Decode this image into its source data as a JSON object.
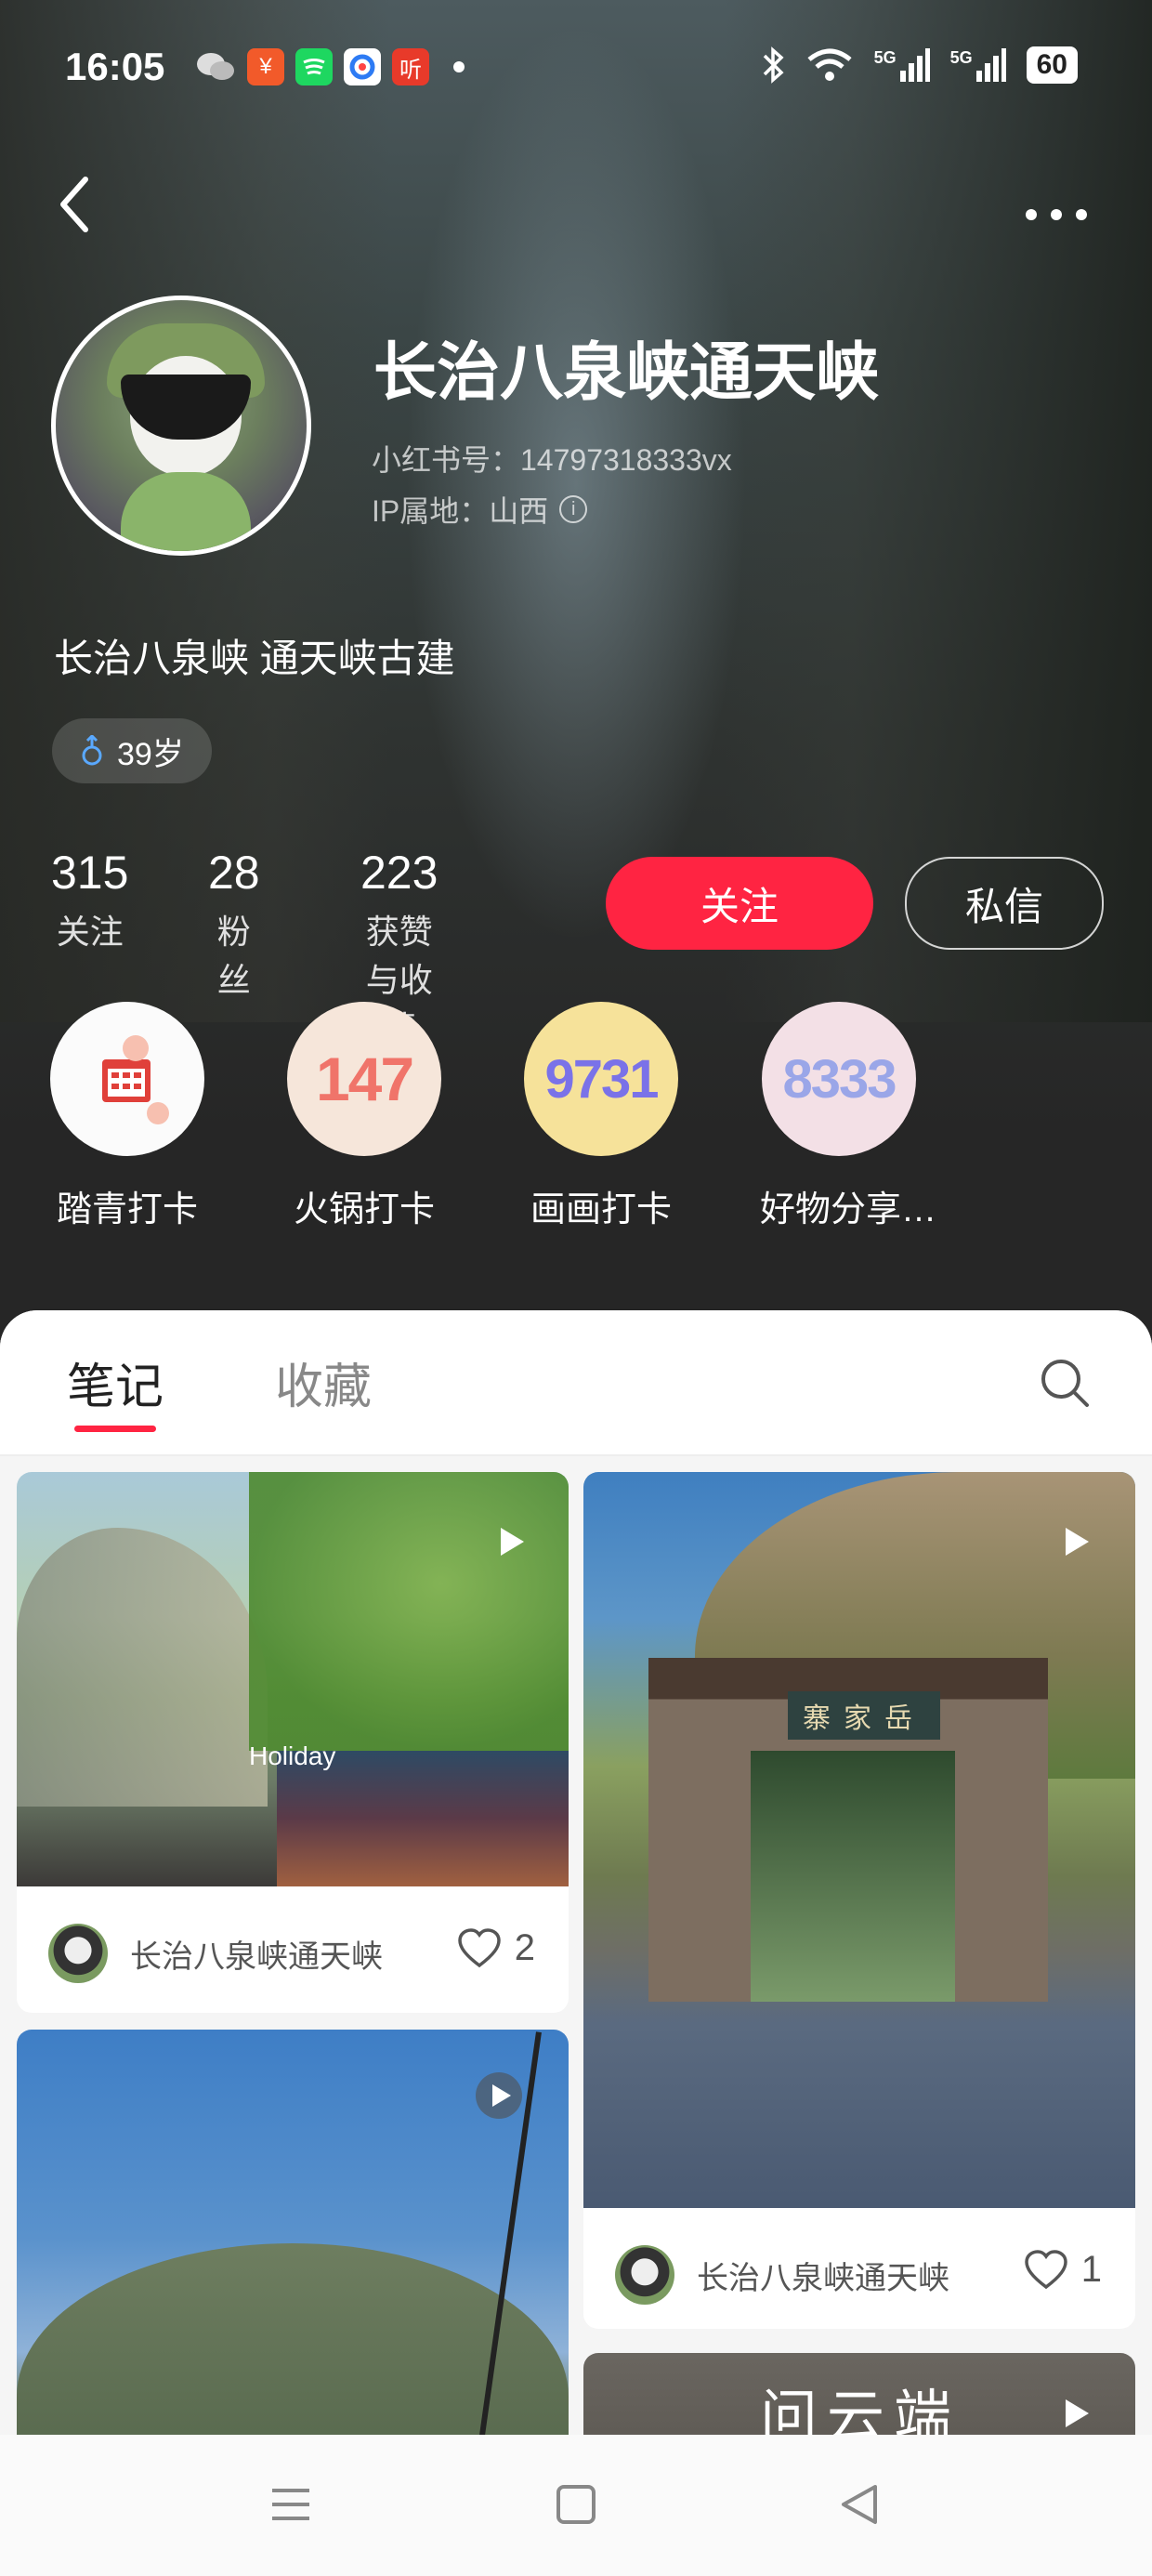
{
  "status_bar": {
    "time": "16:05",
    "battery": "60",
    "network_labels": [
      "5G",
      "5G"
    ],
    "app_badge": "听"
  },
  "header": {
    "back_icon": "chevron-left-icon",
    "more_icon": "more-dots-icon"
  },
  "profile": {
    "name": "长治八泉峡通天峡",
    "red_id": "小红书号：14797318333vx",
    "ip_location": "IP属地：山西",
    "bio": "长治八泉峡 通天峡古建",
    "age": "39岁",
    "gender_icon": "male-icon"
  },
  "stats": [
    {
      "value": "315",
      "label": "关注"
    },
    {
      "value": "28",
      "label": "粉丝"
    },
    {
      "value": "223",
      "label": "获赞与收藏"
    }
  ],
  "actions": {
    "follow": "关注",
    "message": "私信"
  },
  "highlights": [
    {
      "label": "踏青打卡",
      "badge": ""
    },
    {
      "label": "火锅打卡",
      "badge": "147"
    },
    {
      "label": "画画打卡",
      "badge": "9731"
    },
    {
      "label": "好物分享…",
      "badge": "8333"
    }
  ],
  "tabs": {
    "notes": "笔记",
    "collections": "收藏"
  },
  "posts": [
    {
      "author": "长治八泉峡通天峡",
      "likes": "2",
      "overlay_text": "Holiday"
    },
    {
      "author": "长治八泉峡通天峡",
      "likes": "1",
      "overlay_text": "寨家岳"
    },
    {
      "author": "",
      "likes": "",
      "overlay_text": ""
    },
    {
      "author": "",
      "likes": "",
      "overlay_text": "问云端"
    }
  ],
  "colors": {
    "accent": "#ff2442",
    "panel": "#f5f5f5"
  }
}
